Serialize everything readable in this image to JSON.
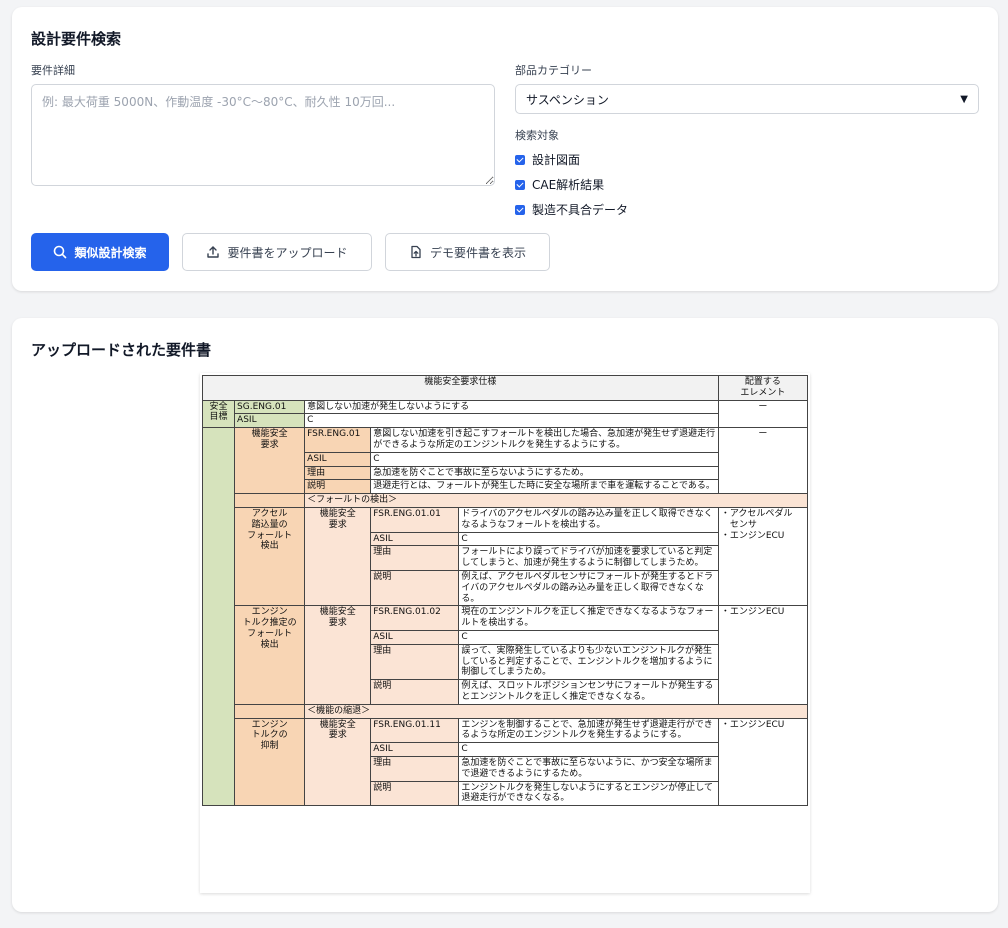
{
  "search": {
    "title": "設計要件検索",
    "detail_label": "要件詳細",
    "detail_placeholder": "例: 最大荷重 5000N、作動温度 -30°C〜80°C、耐久性 10万回...",
    "category_label": "部品カテゴリー",
    "category_value": "サスペンション",
    "target_label": "検索対象",
    "targets": [
      {
        "label": "設計図面",
        "checked": true
      },
      {
        "label": "CAE解析結果",
        "checked": true
      },
      {
        "label": "製造不具合データ",
        "checked": true
      }
    ],
    "buttons": {
      "search": "類似設計検索",
      "upload": "要件書をアップロード",
      "demo": "デモ要件書を表示"
    }
  },
  "uploaded": {
    "title": "アップロードされた要件書",
    "doc": {
      "header": "機能安全要求仕様",
      "element_header": "配置する\nエレメント",
      "safety_goal_label": "安全\n目標",
      "sg_id": "SG.ENG.01",
      "sg_text": "意図しない加速が発生しないようにする",
      "sg_element": "ー",
      "asil": "ASIL",
      "asil_value": "C",
      "reason": "理由",
      "explain": "説明",
      "fsr_label": "機能安全\n要求",
      "fsr01_id": "FSR.ENG.01",
      "fsr01_text": "意図しない加速を引き起こすフォールトを検出した場合、急加速が発生せず退避走行ができるような所定のエンジントルクを発生するようにする。",
      "fsr01_element": "ー",
      "fsr01_reason": "急加速を防ぐことで事故に至らないようにするため。",
      "fsr01_explain": "退避走行とは、フォールトが発生した時に安全な場所まで車を運転することである。",
      "section_detect": "＜フォールトの検出＞",
      "pedal_label": "アクセル\n踏込量の\nフォールト\n検出",
      "fsr0101_id": "FSR.ENG.01.01",
      "fsr0101_text": "ドライバのアクセルペダルの踏み込み量を正しく取得できなくなるようなフォールトを検出する。",
      "fsr0101_element": "・アクセルペダル\n　センサ\n・エンジンECU",
      "fsr0101_reason": "フォールトにより誤ってドライバが加速を要求していると判定してしまうと、加速が発生するように制御してしまうため。",
      "fsr0101_explain": "例えば、アクセルペダルセンサにフォールトが発生するとドライバのアクセルペダルの踏み込み量を正しく取得できなくなる。",
      "torque_est_label": "エンジン\nトルク推定の\nフォールト\n検出",
      "fsr0102_id": "FSR.ENG.01.02",
      "fsr0102_text": "現在のエンジントルクを正しく推定できなくなるようなフォールトを検出する。",
      "fsr0102_element": "・エンジンECU",
      "fsr0102_reason": "誤って、実際発生しているよりも少ないエンジントルクが発生していると判定することで、エンジントルクを増加するように制御してしまうため。",
      "fsr0102_explain": "例えば、スロットルポジションセンサにフォールトが発生するとエンジントルクを正しく推定できなくなる。",
      "section_degrade": "＜機能の縮退＞",
      "torque_lim_label": "エンジン\nトルクの\n抑制",
      "fsr0111_id": "FSR.ENG.01.11",
      "fsr0111_text": "エンジンを制御することで、急加速が発生せず退避走行ができるような所定のエンジントルクを発生するようにする。",
      "fsr0111_element": "・エンジンECU",
      "fsr0111_reason": "急加速を防ぐことで事故に至らないように、かつ安全な場所まで退避できるようにするため。",
      "fsr0111_explain": "エンジントルクを発生しないようにするとエンジンが停止して退避走行ができなくなる。"
    }
  }
}
